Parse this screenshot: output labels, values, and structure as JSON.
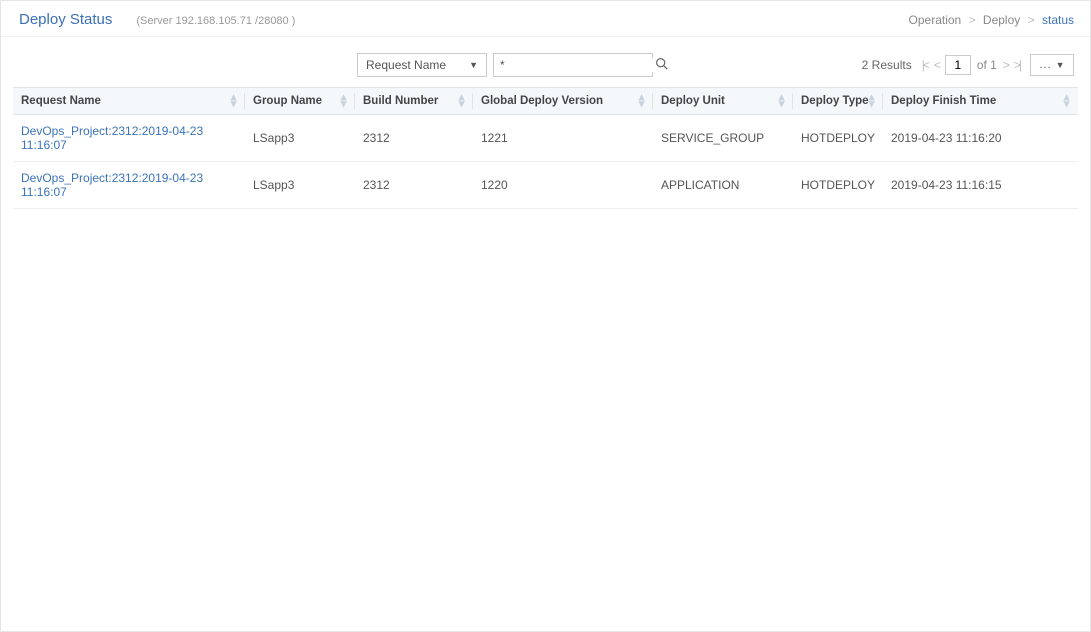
{
  "header": {
    "title": "Deploy Status",
    "server": "(Server 192.168.105.71 /28080 )"
  },
  "breadcrumb": {
    "a": "Operation",
    "b": "Deploy",
    "c": "status",
    "sep": ">"
  },
  "filter": {
    "select_label": "Request Name",
    "search_value": "*"
  },
  "results": {
    "label": "2 Results",
    "page_current": "1",
    "of_label": "of 1",
    "more_label": "..."
  },
  "table": {
    "headers": {
      "request_name": "Request Name",
      "group_name": "Group Name",
      "build_number": "Build Number",
      "global_deploy_version": "Global Deploy Version",
      "deploy_unit": "Deploy Unit",
      "deploy_type": "Deploy Type",
      "deploy_finish_time": "Deploy Finish Time"
    },
    "rows": [
      {
        "request_name": "DevOps_Project:2312:2019-04-23 11:16:07",
        "group_name": "LSapp3",
        "build_number": "2312",
        "global_deploy_version": "1221",
        "deploy_unit": "SERVICE_GROUP",
        "deploy_type": "HOTDEPLOY",
        "deploy_finish_time": "2019-04-23 11:16:20"
      },
      {
        "request_name": "DevOps_Project:2312:2019-04-23 11:16:07",
        "group_name": "LSapp3",
        "build_number": "2312",
        "global_deploy_version": "1220",
        "deploy_unit": "APPLICATION",
        "deploy_type": "HOTDEPLOY",
        "deploy_finish_time": "2019-04-23 11:16:15"
      }
    ]
  }
}
